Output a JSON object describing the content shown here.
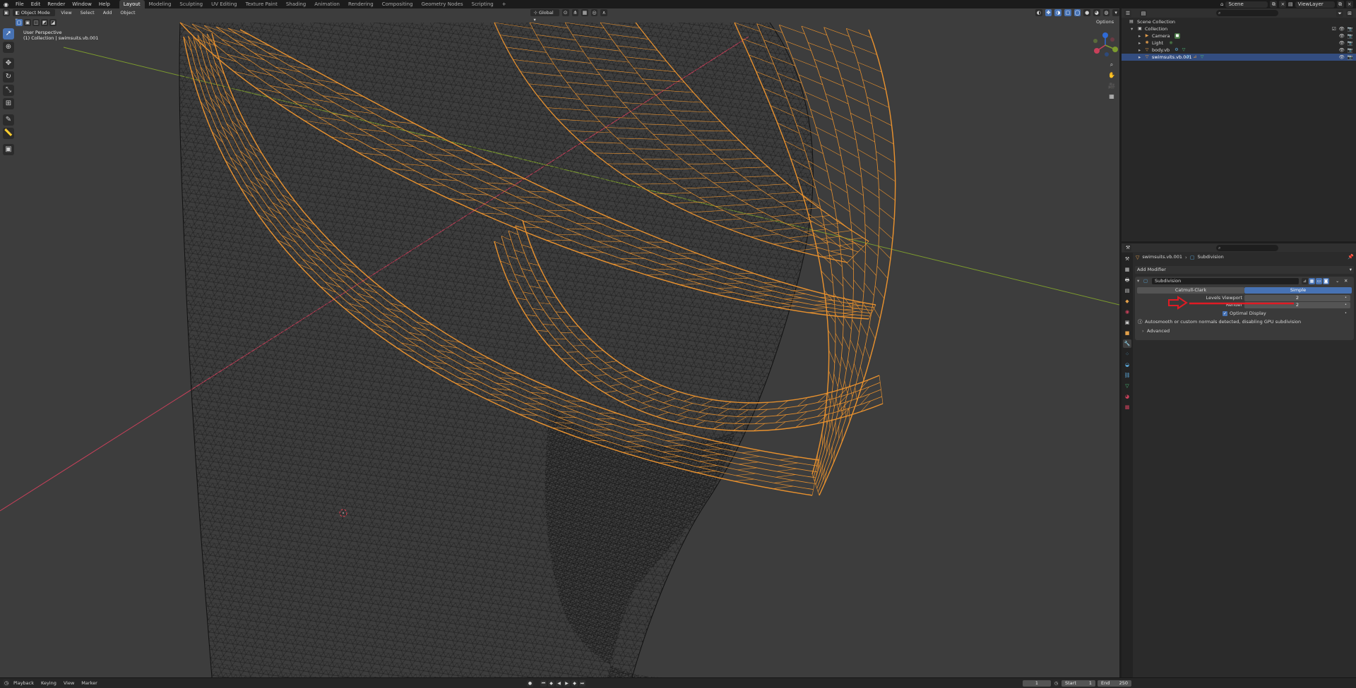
{
  "topbar": {
    "menus": [
      "File",
      "Edit",
      "Render",
      "Window",
      "Help"
    ],
    "workspaces": [
      {
        "label": "Layout",
        "active": true
      },
      {
        "label": "Modeling",
        "active": false
      },
      {
        "label": "Sculpting",
        "active": false
      },
      {
        "label": "UV Editing",
        "active": false
      },
      {
        "label": "Texture Paint",
        "active": false
      },
      {
        "label": "Shading",
        "active": false
      },
      {
        "label": "Animation",
        "active": false
      },
      {
        "label": "Rendering",
        "active": false
      },
      {
        "label": "Compositing",
        "active": false
      },
      {
        "label": "Geometry Nodes",
        "active": false
      },
      {
        "label": "Scripting",
        "active": false
      }
    ],
    "add_workspace": "+",
    "scene": "Scene",
    "view_layer": "ViewLayer"
  },
  "viewport": {
    "mode": "Object Mode",
    "menus": [
      "View",
      "Select",
      "Add",
      "Object"
    ],
    "orientation": "Global",
    "options_label": "Options",
    "info_line1": "User Perspective",
    "info_line2": "(1) Collection | swimsuits.vb.001",
    "gizmo_labels": {
      "x": "X",
      "y": "Y",
      "z": "Z"
    },
    "colors": {
      "background": "#3d3d3d",
      "wire": "#0d0d0d",
      "selected_wire": "#e8912e",
      "x_axis": "#c8405a",
      "y_axis": "#7c9b2e"
    }
  },
  "timeline": {
    "menus": [
      "Playback",
      "Keying",
      "View",
      "Marker"
    ],
    "current_frame": "1",
    "start_label": "Start",
    "start": "1",
    "end_label": "End",
    "end": "250"
  },
  "outliner": {
    "search_placeholder": "",
    "rows": [
      {
        "label": "Scene Collection",
        "icon": "scene-collection-icon"
      },
      {
        "label": "Collection",
        "icon": "collection-icon"
      },
      {
        "label": "Camera",
        "icon": "camera-icon"
      },
      {
        "label": "Light",
        "icon": "light-icon"
      },
      {
        "label": "body.vb",
        "icon": "mesh-icon"
      },
      {
        "label": "swimsuits.vb.001",
        "icon": "mesh-icon",
        "selected": true
      }
    ]
  },
  "properties": {
    "breadcrumb_object": "swimsuits.vb.001",
    "breadcrumb_modifier": "Subdivision",
    "add_modifier": "Add Modifier",
    "modifier_name": "Subdivision",
    "type_options": [
      {
        "label": "Catmull-Clark",
        "active": false
      },
      {
        "label": "Simple",
        "active": true
      }
    ],
    "levels_viewport_label": "Levels Viewport",
    "levels_viewport_value": "2",
    "render_label": "Render",
    "render_value": "2",
    "optimal_display_label": "Optimal Display",
    "optimal_display_checked": true,
    "warning": "Autosmooth or custom normals detected, disabling GPU subdivision",
    "advanced_label": "Advanced",
    "annotation_color": "#e01b24"
  }
}
